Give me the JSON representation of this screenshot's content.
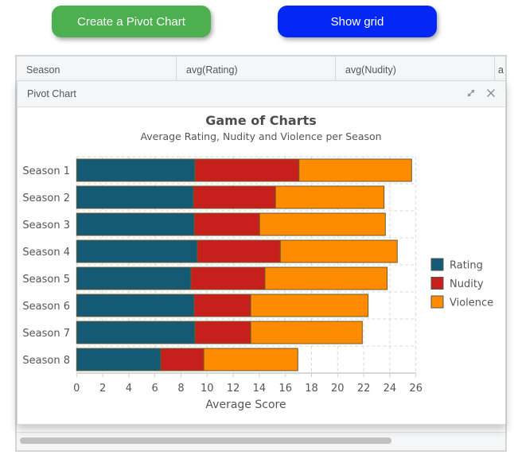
{
  "toolbar": {
    "create_chart_label": "Create a Pivot Chart",
    "show_grid_label": "Show grid",
    "create_chart_color": "#4caf50",
    "show_grid_color": "#0427f6"
  },
  "grid": {
    "columns": [
      "Season",
      "avg(Rating)",
      "avg(Nudity)",
      "a"
    ]
  },
  "popup": {
    "title": "Pivot Chart",
    "expand_icon": "expand-arrows-icon",
    "close_icon": "close-x-icon"
  },
  "chart_data": {
    "type": "bar",
    "orientation": "horizontal",
    "stacked": true,
    "title": "Game of Charts",
    "subtitle": "Average Rating, Nudity and Violence per Season",
    "xlabel": "Average Score",
    "ylabel": "",
    "xlim": [
      0,
      26
    ],
    "xticks": [
      0,
      2,
      4,
      6,
      8,
      10,
      12,
      14,
      16,
      18,
      20,
      22,
      24,
      26
    ],
    "grid": true,
    "legend_position": "right",
    "categories": [
      "Season 1",
      "Season 2",
      "Season 3",
      "Season 4",
      "Season 5",
      "Season 6",
      "Season 7",
      "Season 8"
    ],
    "series": [
      {
        "name": "Rating",
        "color": "#155a74",
        "values": [
          9.07,
          8.96,
          9.02,
          9.25,
          8.76,
          9.01,
          9.07,
          6.45
        ]
      },
      {
        "name": "Nudity",
        "color": "#c7201c",
        "values": [
          7.97,
          6.28,
          5.0,
          6.36,
          5.67,
          4.33,
          4.27,
          3.29
        ]
      },
      {
        "name": "Violence",
        "color": "#ff8c00",
        "values": [
          8.63,
          8.32,
          9.64,
          8.96,
          9.37,
          9.0,
          8.55,
          7.21
        ]
      }
    ]
  }
}
